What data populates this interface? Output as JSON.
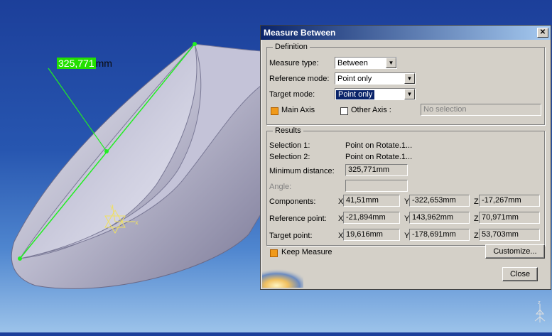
{
  "viewer": {
    "measure_value": "325,771",
    "measure_unit": "mm"
  },
  "dialog": {
    "title": "Measure Between",
    "close_glyph": "✕",
    "definition": {
      "legend": "Definition",
      "measure_type_label": "Measure type:",
      "measure_type_value": "Between",
      "reference_mode_label": "Reference mode:",
      "reference_mode_value": "Point only",
      "target_mode_label": "Target mode:",
      "target_mode_value": "Point only",
      "main_axis_label": "Main Axis",
      "other_axis_label": "Other Axis :",
      "other_axis_value": "No selection"
    },
    "results": {
      "legend": "Results",
      "selection1_label": "Selection 1:",
      "selection1_value": "Point on Rotate.1...",
      "selection2_label": "Selection 2:",
      "selection2_value": "Point on Rotate.1...",
      "min_distance_label": "Minimum distance:",
      "min_distance_value": "325,771mm",
      "angle_label": "Angle:",
      "components_label": "Components:",
      "components": {
        "x": "41,51mm",
        "y": "-322,653mm",
        "z": "-17,267mm"
      },
      "reference_point_label": "Reference point:",
      "reference_point": {
        "x": "-21,894mm",
        "y": "143,962mm",
        "z": "70,971mm"
      },
      "target_point_label": "Target point:",
      "target_point": {
        "x": "19,616mm",
        "y": "-178,691mm",
        "z": "53,703mm"
      },
      "axis_x": "X",
      "axis_y": "Y",
      "axis_z": "Z"
    },
    "keep_measure_label": "Keep Measure",
    "customize_label": "Customize...",
    "close_label": "Close"
  }
}
